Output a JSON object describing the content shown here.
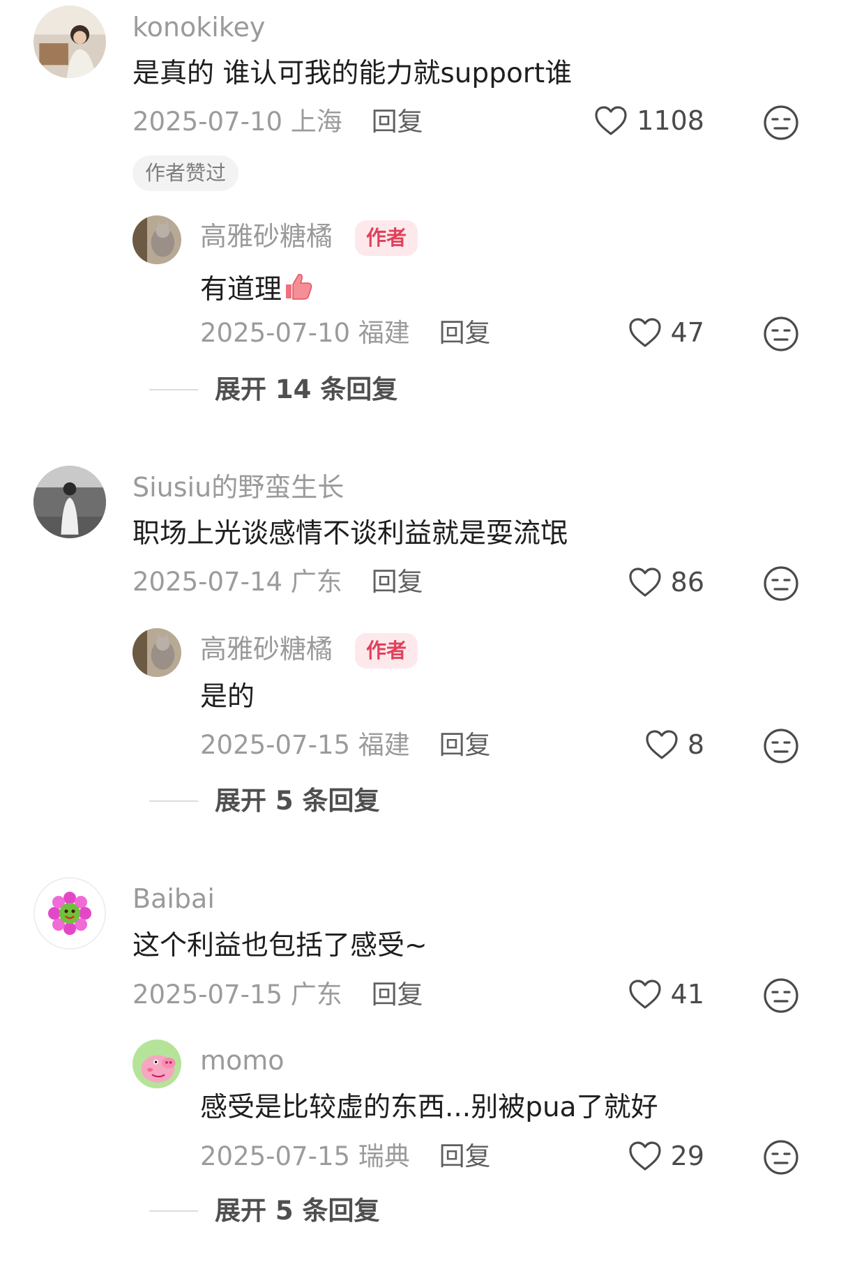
{
  "comments": [
    {
      "username": "konokikey",
      "text": "是真的 谁认可我的能力就support谁",
      "date": "2025-07-10",
      "location": "上海",
      "reply_label": "回复",
      "likes": "1108",
      "badge": "作者赞过"
    },
    {
      "username": "高雅砂糖橘",
      "author_tag": "作者",
      "text": "有道理",
      "text_emoji": "thumbs-up-icon",
      "date": "2025-07-10",
      "location": "福建",
      "reply_label": "回复",
      "likes": "47"
    },
    {
      "username": "Siusiu的野蛮生长",
      "text": "职场上光谈感情不谈利益就是耍流氓",
      "date": "2025-07-14",
      "location": "广东",
      "reply_label": "回复",
      "likes": "86"
    },
    {
      "username": "高雅砂糖橘",
      "author_tag": "作者",
      "text": "是的",
      "date": "2025-07-15",
      "location": "福建",
      "reply_label": "回复",
      "likes": "8"
    },
    {
      "username": "Baibai",
      "text": "这个利益也包括了感受~",
      "date": "2025-07-15",
      "location": "广东",
      "reply_label": "回复",
      "likes": "41"
    },
    {
      "username": "momo",
      "text": "感受是比较虚的东西...别被pua了就好",
      "date": "2025-07-15",
      "location": "瑞典",
      "reply_label": "回复",
      "likes": "29"
    }
  ],
  "expanders": [
    {
      "label": "展开 14 条回复"
    },
    {
      "label": "展开 5 条回复"
    },
    {
      "label": "展开 5 条回复"
    }
  ],
  "icons": {
    "like": "heart-outline-icon",
    "dislike": "meh-face-icon"
  },
  "colors": {
    "author_tag_bg": "#fde9ec",
    "author_tag_text": "#e0415a",
    "username": "#9a9a9a",
    "meta": "#9b9b9b"
  }
}
